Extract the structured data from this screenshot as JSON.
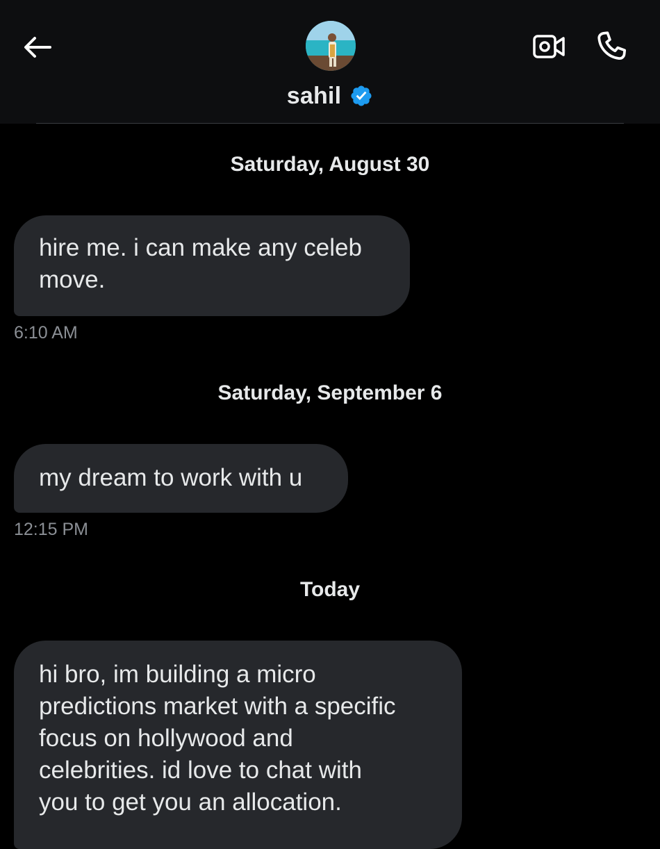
{
  "header": {
    "contact_name": "sahil",
    "back_icon": "arrow-left-icon",
    "video_icon": "video-camera-icon",
    "call_icon": "phone-icon",
    "verified_icon": "verified-badge-icon",
    "verified_color": "#1d9bf0"
  },
  "conversation": {
    "groups": [
      {
        "date": "Saturday, August 30",
        "messages": [
          {
            "lines": [
              "hire me. i can make any celeb",
              "move."
            ],
            "time": "6:10 AM"
          }
        ]
      },
      {
        "date": "Saturday, September 6",
        "messages": [
          {
            "lines": [
              "my dream to work with u"
            ],
            "time": "12:15 PM"
          }
        ]
      },
      {
        "date": "Today",
        "messages": [
          {
            "lines": [
              "hi bro, im building a micro",
              "predictions market with a specific",
              "focus on hollywood and",
              "celebrities. id love to chat with",
              "you to get you an allocation."
            ]
          }
        ]
      }
    ]
  },
  "colors": {
    "background": "#000000",
    "header_background": "#0d0e10",
    "bubble": "#26282c",
    "text": "#e7e9ea",
    "timestamp": "#8b8f95"
  }
}
